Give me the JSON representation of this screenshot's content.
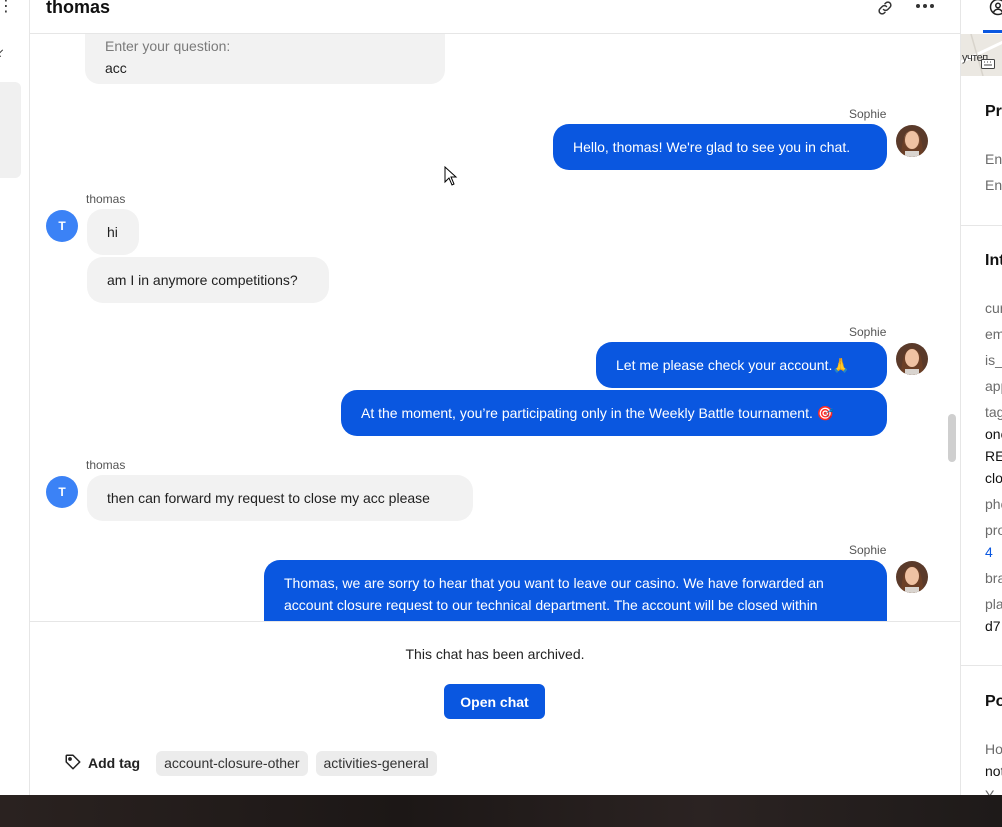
{
  "header": {
    "title": "thomas"
  },
  "quoted": {
    "hint": "Enter your question:",
    "value": "acc"
  },
  "messages": [
    {
      "from": "agent",
      "sender": "Sophie",
      "text": "Hello, thomas! We're glad to see you in chat."
    },
    {
      "from": "user",
      "sender": "thomas",
      "avatar_letter": "T",
      "text": "hi"
    },
    {
      "from": "user",
      "text": "am I in anymore competitions?"
    },
    {
      "from": "agent",
      "sender": "Sophie",
      "text": "Let me please check your account.🙏"
    },
    {
      "from": "agent",
      "text": "At the moment, you’re participating only in the Weekly Battle tournament. 🎯"
    },
    {
      "from": "user",
      "sender": "thomas",
      "avatar_letter": "T",
      "text": "then can forward my request to close my acc please"
    },
    {
      "from": "agent",
      "sender": "Sophie",
      "text_line1": "Thomas, we are sorry to hear that you want to leave our casino. We have forwarded an",
      "text_line2": "account closure request to our technical department. The account will be closed within"
    }
  ],
  "footer": {
    "archived_text": "This chat has been archived.",
    "open_chat_label": "Open chat",
    "add_tag_label": "Add tag",
    "tags": [
      "account-closure-other",
      "activities-general"
    ]
  },
  "right_panel": {
    "map_label": "учтеп",
    "section_profile": "Pro",
    "profile_lines": [
      "Ent",
      "Ent"
    ],
    "section_integrations": "Int",
    "integration_labels": [
      "cur",
      "em",
      "is_",
      "app",
      "tag"
    ],
    "tag_values": [
      "one",
      "RE",
      "clo"
    ],
    "phone_label": "pho",
    "pro_label": "pro",
    "pro_value": "4",
    "brand_label": "bra",
    "platform_label": "pla",
    "platform_value": "d7",
    "section_po": "Po",
    "po_label": "Ho",
    "po_value": "not",
    "po_partial": "Y"
  },
  "colors": {
    "accent": "#0a57e0",
    "user_avatar": "#3b82f6",
    "incoming_bubble": "#f2f2f2"
  },
  "icons": [
    "menu-icon",
    "chevron-icon",
    "link-icon",
    "more-icon",
    "tag-icon",
    "profile-tab-icon",
    "keyboard-icon",
    "mouse-cursor-icon"
  ]
}
